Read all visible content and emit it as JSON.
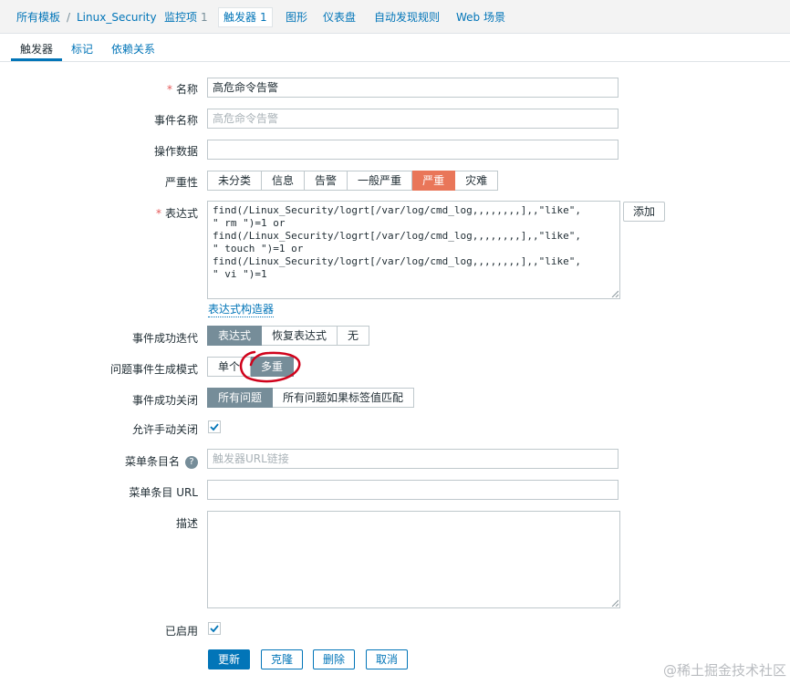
{
  "nav": {
    "templates": "所有模板",
    "host": "Linux_Security",
    "items": {
      "label": "监控项",
      "count": "1"
    },
    "triggers": {
      "label": "触发器",
      "count": "1"
    },
    "graphs": "图形",
    "dashboards": "仪表盘",
    "discovery": "自动发现规则",
    "web": "Web 场景"
  },
  "subtabs": {
    "trigger": "触发器",
    "tags": "标记",
    "dependencies": "依赖关系"
  },
  "form": {
    "name": {
      "label": "名称",
      "value": "高危命令告警"
    },
    "event_name": {
      "label": "事件名称",
      "placeholder": "高危命令告警"
    },
    "opdata": {
      "label": "操作数据",
      "value": ""
    },
    "severity": {
      "label": "严重性",
      "options": [
        "未分类",
        "信息",
        "告警",
        "一般严重",
        "严重",
        "灾难"
      ],
      "selected": "严重"
    },
    "expression": {
      "label": "表达式",
      "lines": [
        "find(/Linux_Security/logrt[/var/log/cmd_log,,,,,,,,],,\"like\",",
        "\" rm \")=1 or",
        "find(/Linux_Security/logrt[/var/log/cmd_log,,,,,,,,],,\"like\",",
        "\" touch \")=1 or",
        "find(/Linux_Security/logrt[/var/log/cmd_log,,,,,,,,],,\"like\",",
        "\" vi \")=1"
      ],
      "add_button": "添加",
      "constructor_link": "表达式构造器"
    },
    "ok_event_gen": {
      "label": "事件成功迭代",
      "options": [
        "表达式",
        "恢复表达式",
        "无"
      ],
      "selected": "表达式"
    },
    "problem_mode": {
      "label": "问题事件生成模式",
      "options": [
        "单个",
        "多重"
      ],
      "selected": "多重"
    },
    "ok_close": {
      "label": "事件成功关闭",
      "options": [
        "所有问题",
        "所有问题如果标签值匹配"
      ],
      "selected": "所有问题"
    },
    "manual_close": {
      "label": "允许手动关闭",
      "checked": true
    },
    "url_name": {
      "label": "菜单条目名",
      "placeholder": "触发器URL链接"
    },
    "url": {
      "label": "菜单条目 URL",
      "value": ""
    },
    "description": {
      "label": "描述",
      "value": ""
    },
    "enabled": {
      "label": "已启用",
      "checked": true
    }
  },
  "buttons": {
    "update": "更新",
    "clone": "克隆",
    "delete": "删除",
    "cancel": "取消"
  },
  "watermark": "@稀土掘金技术社区",
  "colors": {
    "accent": "#0275b8",
    "severity_high": "#e97659",
    "selected_segment": "#768d99",
    "annotation": "#d0021b"
  }
}
